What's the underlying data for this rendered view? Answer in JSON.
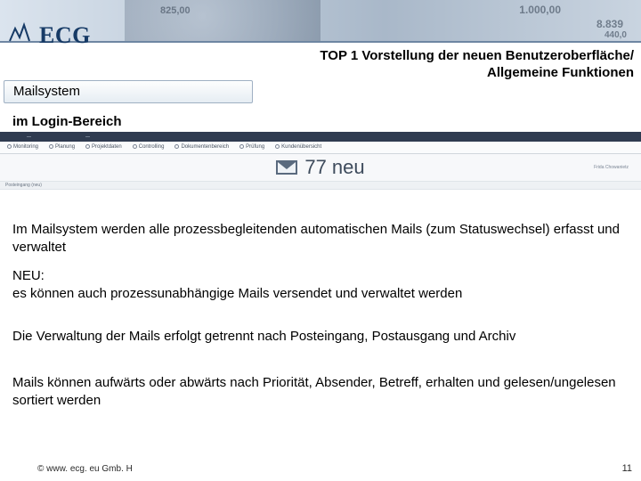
{
  "logo_text": "ECG",
  "banner_numbers": {
    "n1": "825,00",
    "n2": "1.000,00",
    "n3": "8.839",
    "n4": "440,0"
  },
  "title": {
    "line1": "TOP 1 Vorstellung der neuen Benutzeroberfläche/",
    "line2": "Allgemeine Funktionen"
  },
  "section_label": "Mailsystem",
  "subtitle": "im Login-Bereich",
  "screenshot": {
    "tabs": [
      "Monitoring",
      "Planung",
      "Projektdaten",
      "Controlling",
      "Dokumentenbereich",
      "Prüfung",
      "Kundenübersicht"
    ],
    "mail_count_text": "77 neu",
    "right_meta": "Frida Chowanietz",
    "sub_label": "Posteingang (neu)"
  },
  "paragraphs": {
    "p1": "Im Mailsystem werden alle prozessbegleitenden automatischen Mails (zum Statuswechsel) erfasst und verwaltet",
    "p2_label": "NEU:",
    "p2_body": "es können auch prozessunabhängige Mails versendet und verwaltet werden",
    "p3": "Die Verwaltung der Mails erfolgt getrennt nach Posteingang, Postausgang und Archiv",
    "p4": "Mails können aufwärts oder abwärts nach Priorität, Absender, Betreff, erhalten und gelesen/ungelesen sortiert werden"
  },
  "footer": {
    "left": "© www. ecg. eu Gmb. H",
    "right": "11"
  }
}
